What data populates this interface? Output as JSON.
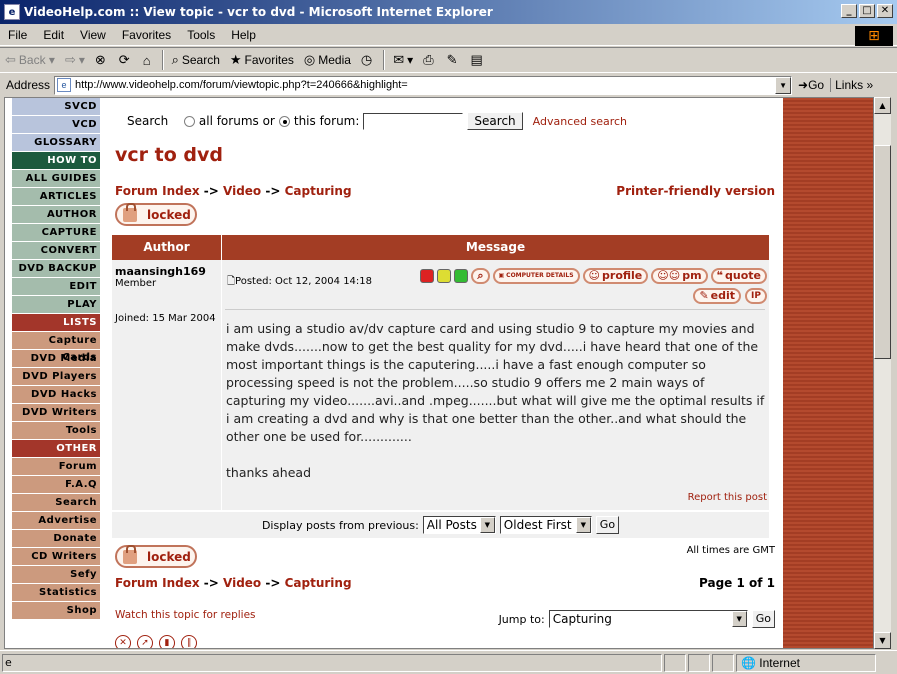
{
  "window": {
    "title": "VideoHelp.com :: View topic - vcr to dvd - Microsoft Internet Explorer"
  },
  "menu": [
    "File",
    "Edit",
    "View",
    "Favorites",
    "Tools",
    "Help"
  ],
  "toolbar": {
    "back": "Back",
    "search": "Search",
    "favorites": "Favorites",
    "media": "Media"
  },
  "address": {
    "label": "Address",
    "url": "http://www.videohelp.com/forum/viewtopic.php?t=240666&highlight=",
    "go": "Go",
    "links": "Links"
  },
  "status": {
    "zone": "Internet"
  },
  "nav": [
    {
      "label": "SVCD",
      "style": "b"
    },
    {
      "label": "VCD",
      "style": "b"
    },
    {
      "label": "GLOSSARY",
      "style": "b"
    },
    {
      "label": "HOW TO",
      "style": "hdr-g"
    },
    {
      "label": "ALL GUIDES",
      "style": "g"
    },
    {
      "label": "ARTICLES",
      "style": "g"
    },
    {
      "label": "AUTHOR",
      "style": "g"
    },
    {
      "label": "CAPTURE",
      "style": "g"
    },
    {
      "label": "CONVERT",
      "style": "g"
    },
    {
      "label": "DVD BACKUP",
      "style": "g"
    },
    {
      "label": "EDIT",
      "style": "g"
    },
    {
      "label": "PLAY",
      "style": "g"
    },
    {
      "label": "LISTS",
      "style": "hdr-r"
    },
    {
      "label": "Capture Cards",
      "style": "r"
    },
    {
      "label": "DVD Media",
      "style": "r"
    },
    {
      "label": "DVD Players",
      "style": "r"
    },
    {
      "label": "DVD Hacks",
      "style": "r"
    },
    {
      "label": "DVD Writers",
      "style": "r"
    },
    {
      "label": "Tools",
      "style": "r"
    },
    {
      "label": "OTHER",
      "style": "hdr-r"
    },
    {
      "label": "Forum",
      "style": "r"
    },
    {
      "label": "F.A.Q",
      "style": "r"
    },
    {
      "label": "Search",
      "style": "r"
    },
    {
      "label": "Advertise",
      "style": "r"
    },
    {
      "label": "Donate",
      "style": "r"
    },
    {
      "label": "CD Writers",
      "style": "r"
    },
    {
      "label": "Sefy",
      "style": "r"
    },
    {
      "label": "Statistics",
      "style": "r"
    },
    {
      "label": "Shop",
      "style": "r"
    }
  ],
  "search": {
    "label": "Search",
    "opt1": "all forums or",
    "opt2": "this forum:",
    "button": "Search",
    "advanced": "Advanced search"
  },
  "topic": {
    "title": "vcr to dvd",
    "printer": "Printer-friendly version"
  },
  "breadcrumb": {
    "a": "Forum Index",
    "sep": "->",
    "b": "Video",
    "c": "Capturing"
  },
  "locked": "locked",
  "table": {
    "author": "Author",
    "message": "Message"
  },
  "post": {
    "author": "maansingh169",
    "rank": "Member",
    "joined": "Joined: 15 Mar 2004",
    "posted": "Posted: Oct 12, 2004 14:18",
    "btn_computer": "COMPUTER DETAILS",
    "btn_profile": "profile",
    "btn_pm": "pm",
    "btn_quote": "quote",
    "btn_edit": "edit",
    "btn_ip": "IP",
    "body": "i am using a studio av/dv capture card and using studio 9 to capture my movies and make dvds.......now to get the best quality for my dvd.....i have heard that one of the most important things is the caputering.....i have a fast enough computer so processing speed is not the problem.....so studio 9 offers me 2 main ways of capturing my video.......avi..and .mpeg.......but what will give me the optimal results if i am creating a dvd and why is that one better than the other..and what should the other one be used for.............",
    "thanks": "thanks ahead",
    "report": "Report this post"
  },
  "display": {
    "label": "Display posts from previous:",
    "all": "All Posts",
    "order": "Oldest First",
    "go": "Go"
  },
  "gmt": "All times are GMT",
  "page": "Page 1 of 1",
  "watch": "Watch this topic for replies",
  "jump": {
    "label": "Jump to:",
    "value": "Capturing",
    "go": "Go"
  }
}
